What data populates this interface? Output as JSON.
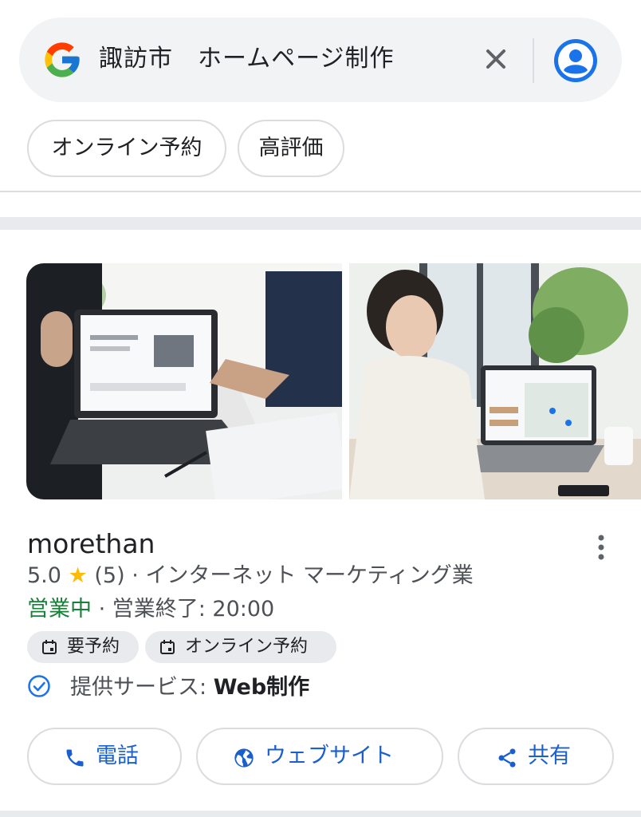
{
  "search": {
    "query": "諏訪市　ホームページ制作",
    "logo_icon": "google-g-logo",
    "clear_icon": "close-icon",
    "avatar_icon": "account-circle-icon"
  },
  "filters": [
    {
      "label": "オンライン予約"
    },
    {
      "label": "高評価"
    }
  ],
  "business": {
    "name": "morethan",
    "rating": "5.0",
    "review_count": "(5)",
    "category": "インターネット マーケティング業",
    "status": "営業中",
    "hours": "営業終了: 20:00",
    "tags": [
      {
        "icon": "calendar-icon",
        "label": "要予約"
      },
      {
        "icon": "calendar-icon",
        "label": "オンライン予約"
      }
    ],
    "service_label": "提供サービス: ",
    "service_value": "Web制作",
    "actions": [
      {
        "icon": "phone-icon",
        "label": "電話"
      },
      {
        "icon": "globe-icon",
        "label": "ウェブサイト"
      },
      {
        "icon": "share-icon",
        "label": "共有"
      }
    ]
  },
  "colors": {
    "accent": "#1a5fd0",
    "open_status": "#188038",
    "star": "#fbbc04",
    "chip_border": "#dadce0"
  }
}
